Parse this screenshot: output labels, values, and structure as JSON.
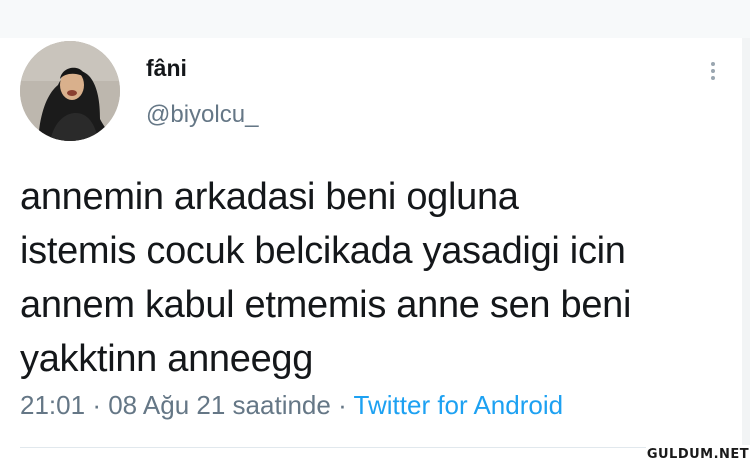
{
  "tweet": {
    "display_name": "fâni",
    "handle": "@biyolcu_",
    "text_lines": [
      "annemin arkadasi beni ogluna",
      "istemis cocuk belcikada yasadigi icin",
      "annem kabul etmemis anne sen beni",
      "yakktinn anneegg"
    ],
    "time": "21:01",
    "separator": "·",
    "date": "08 Ağu 21 saatinde",
    "source": "Twitter for Android",
    "more_icon": "more-vertical-icon"
  },
  "watermark": {
    "text": "GULDUM.NET"
  },
  "colors": {
    "text_primary": "#14171a",
    "text_secondary": "#657786",
    "link": "#1da1f2",
    "divider": "#e1e8ed"
  }
}
